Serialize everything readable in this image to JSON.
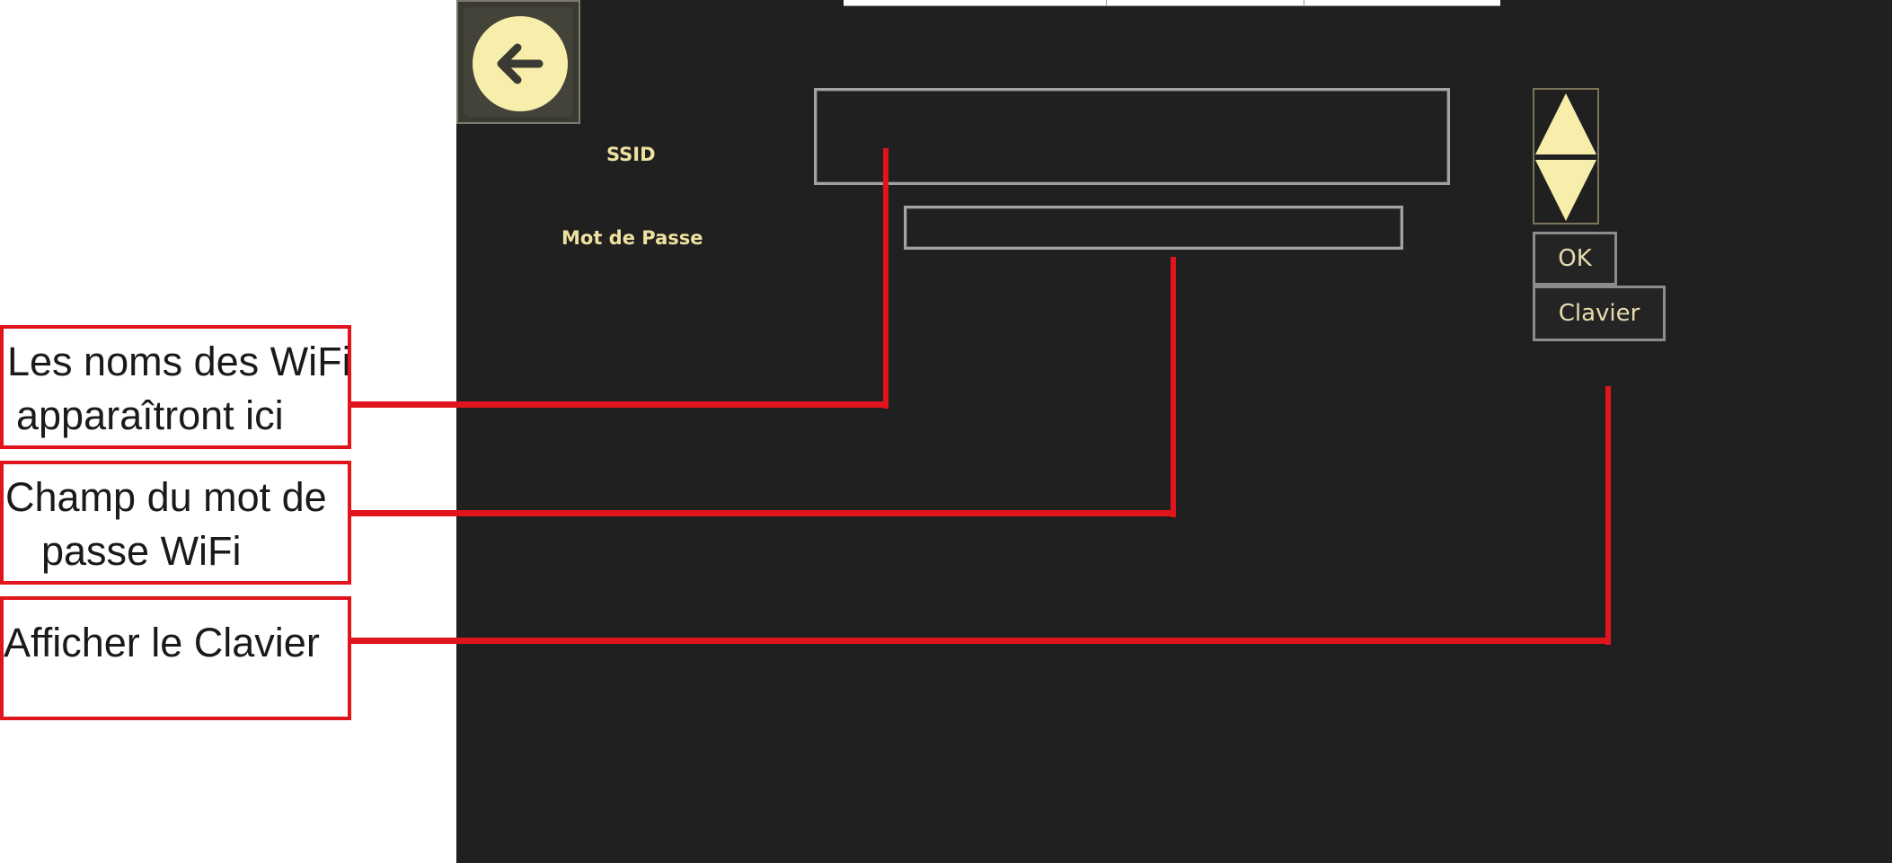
{
  "screen": {
    "back_button": {
      "icon": "arrow-left-icon"
    },
    "ssid_label": "SSID",
    "password_label": "Mot de Passe",
    "spinner": {
      "up_icon": "triangle-up-icon",
      "down_icon": "triangle-down-icon"
    },
    "ok_label": "OK",
    "keyboard_label": "Clavier"
  },
  "annotations": [
    {
      "line1": "Les noms des WiFi",
      "line2": " apparaîtront ici"
    },
    {
      "line1": "Champ du mot de",
      "line2": "passe WiFi"
    },
    {
      "line1": "Afficher le Clavier",
      "line2": ""
    }
  ],
  "colors": {
    "background": "#202020",
    "label_text": "#efe2a0",
    "accent_yellow": "#f7eeab",
    "annotation_red": "#e0141b"
  }
}
